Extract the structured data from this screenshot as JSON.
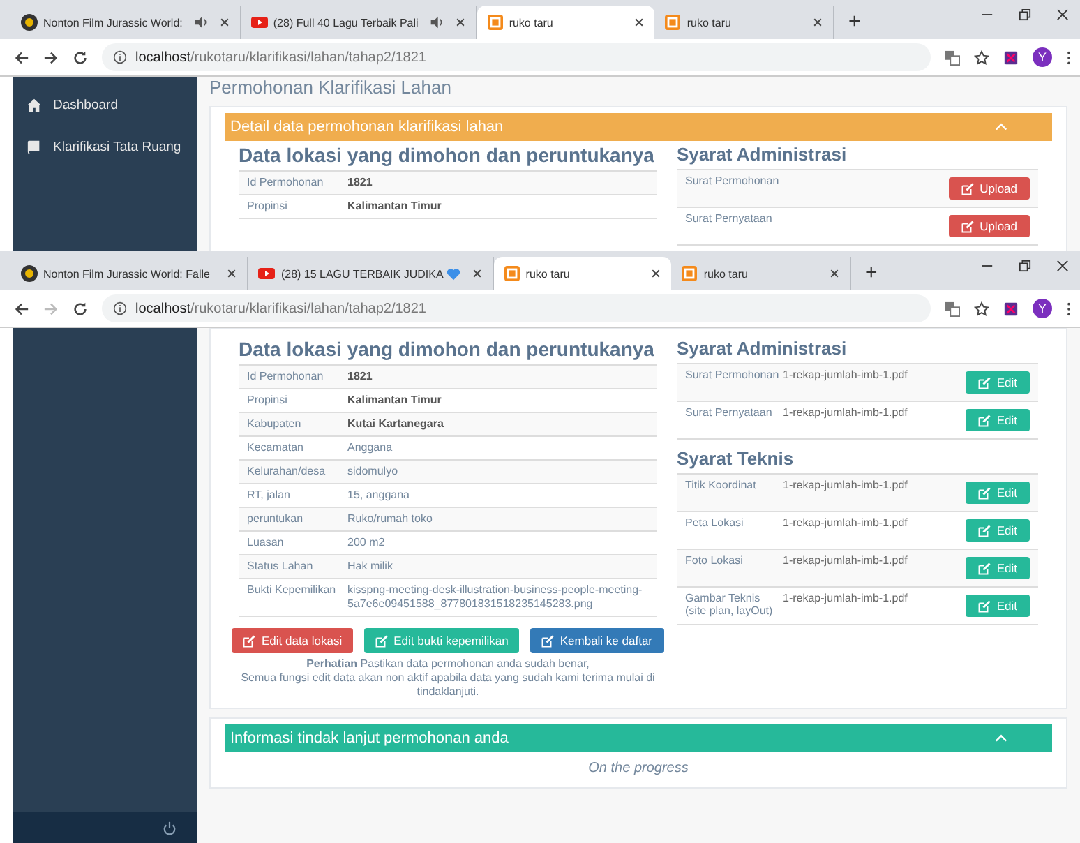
{
  "screens": [
    {
      "tabs": [
        {
          "title": "Nonton Film Jurassic World:",
          "audio": true,
          "selected": false
        },
        {
          "title": "(28) Full 40 Lagu Terbaik Pali",
          "audio": true,
          "selected": false
        },
        {
          "title": "ruko taru",
          "audio": false,
          "selected": true
        },
        {
          "title": "ruko taru",
          "audio": false,
          "selected": false
        }
      ],
      "new_tab": "+",
      "forward_enabled": true,
      "url": {
        "host": "localhost",
        "path": "/rukotaru/klarifikasi/lahan/tahap2/1821"
      },
      "avatar": "Y",
      "sidebar": {
        "items": [
          {
            "label": "Dashboard"
          },
          {
            "label": "Klarifikasi Tata Ruang"
          }
        ]
      },
      "page_title": "Permohonan Klarifikasi Lahan",
      "detail_panel": {
        "title": "Detail data permohonan klarifikasi lahan",
        "location": {
          "heading": "Data lokasi yang dimohon dan peruntukanya",
          "rows": [
            {
              "label": "Id Permohonan",
              "value": "1821",
              "bold": true
            },
            {
              "label": "Propinsi",
              "value": "Kalimantan Timur",
              "bold": true
            }
          ]
        },
        "requirements": [
          {
            "heading": "Syarat Administrasi",
            "rows": [
              {
                "label": "Surat Permohonan",
                "button": {
                  "kind": "upload",
                  "label": "Upload"
                }
              },
              {
                "label": "Surat Pernyataan",
                "button": {
                  "kind": "upload",
                  "label": "Upload"
                }
              }
            ]
          }
        ]
      }
    },
    {
      "tabs": [
        {
          "title": "Nonton Film Jurassic World: Falle",
          "audio": false,
          "selected": false
        },
        {
          "title": "(28) 15 LAGU TERBAIK JUDIKA",
          "heart": true,
          "audio": false,
          "selected": false
        },
        {
          "title": "ruko taru",
          "audio": false,
          "selected": true
        },
        {
          "title": "ruko taru",
          "audio": false,
          "selected": false
        }
      ],
      "new_tab": "+",
      "forward_enabled": false,
      "url": {
        "host": "localhost",
        "path": "/rukotaru/klarifikasi/lahan/tahap2/1821"
      },
      "avatar": "Y",
      "sidebar": {
        "power_footer": true
      },
      "detail_panel": {
        "location": {
          "heading": "Data lokasi yang dimohon dan peruntukanya",
          "rows": [
            {
              "label": "Id Permohonan",
              "value": "1821",
              "bold": true
            },
            {
              "label": "Propinsi",
              "value": "Kalimantan Timur",
              "bold": true
            },
            {
              "label": "Kabupaten",
              "value": "Kutai Kartanegara",
              "bold": true
            },
            {
              "label": "Kecamatan",
              "value": "Anggana",
              "bold": false
            },
            {
              "label": "Kelurahan/desa",
              "value": "sidomulyo",
              "bold": false
            },
            {
              "label": "RT, jalan",
              "value": "15, anggana",
              "bold": false
            },
            {
              "label": "peruntukan",
              "value": "Ruko/rumah toko",
              "bold": false
            },
            {
              "label": "Luasan",
              "value": "200 m2",
              "bold": false
            },
            {
              "label": "Status Lahan",
              "value": "Hak milik",
              "bold": false
            },
            {
              "label": "Bukti Kepemilikan",
              "value": "kisspng-meeting-desk-illustration-business-people-meeting-5a7e6e09451588_877801831518235145283.png",
              "bold": false
            }
          ],
          "actions": [
            {
              "kind": "danger",
              "label": "Edit data lokasi"
            },
            {
              "kind": "success",
              "label": "Edit bukti kepemilikan"
            },
            {
              "kind": "primary",
              "label": "Kembali ke daftar"
            }
          ],
          "notice": "**Perhatian** Pastikan data permohonan anda sudah benar,\nSemua fungsi edit data akan non aktif apabila data yang sudah kami terima mulai di tindaklanjuti."
        },
        "requirements": [
          {
            "heading": "Syarat Administrasi",
            "rows": [
              {
                "label": "Surat Permohonan",
                "file": "1-rekap-jumlah-imb-1.pdf",
                "button": {
                  "kind": "edit",
                  "label": "Edit"
                }
              },
              {
                "label": "Surat Pernyataan",
                "file": "1-rekap-jumlah-imb-1.pdf",
                "button": {
                  "kind": "edit",
                  "label": "Edit"
                }
              }
            ]
          },
          {
            "heading": "Syarat Teknis",
            "rows": [
              {
                "label": "Titik Koordinat",
                "file": "1-rekap-jumlah-imb-1.pdf",
                "button": {
                  "kind": "edit",
                  "label": "Edit"
                }
              },
              {
                "label": "Peta Lokasi",
                "file": "1-rekap-jumlah-imb-1.pdf",
                "button": {
                  "kind": "edit",
                  "label": "Edit"
                }
              },
              {
                "label": "Foto Lokasi",
                "file": "1-rekap-jumlah-imb-1.pdf",
                "button": {
                  "kind": "edit",
                  "label": "Edit"
                }
              },
              {
                "label": "Gambar Teknis (site plan, layOut)",
                "file": "1-rekap-jumlah-imb-1.pdf",
                "button": {
                  "kind": "edit",
                  "label": "Edit"
                }
              }
            ]
          }
        ]
      },
      "followup_panel": {
        "title": "Informasi tindak lanjut permohonan anda",
        "status": "On the progress"
      }
    }
  ]
}
